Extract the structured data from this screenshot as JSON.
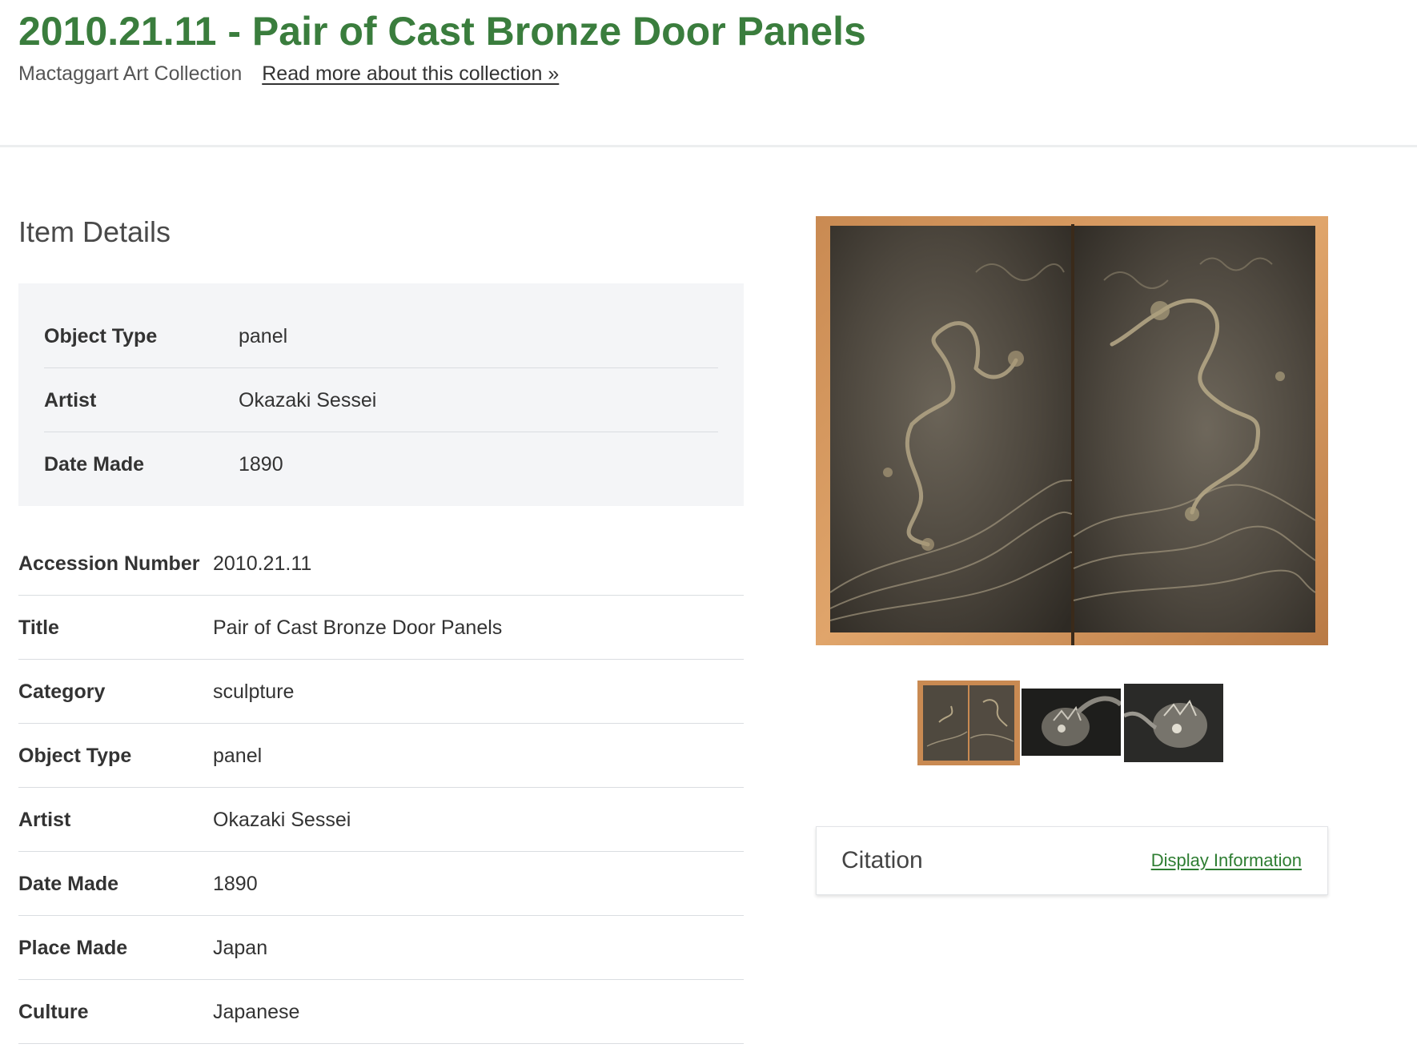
{
  "header": {
    "title": "2010.21.11 - Pair of Cast Bronze Door Panels",
    "collection_name": "Mactaggart Art Collection",
    "collection_link": "Read more about this collection »"
  },
  "item_details": {
    "heading": "Item Details",
    "summary": [
      {
        "label": "Object Type",
        "value": "panel"
      },
      {
        "label": "Artist",
        "value": "Okazaki Sessei"
      },
      {
        "label": "Date Made",
        "value": "1890"
      }
    ],
    "fields": [
      {
        "label": "Accession Number",
        "value": "2010.21.11"
      },
      {
        "label": "Title",
        "value": "Pair of Cast Bronze Door Panels"
      },
      {
        "label": "Category",
        "value": "sculpture"
      },
      {
        "label": "Object Type",
        "value": "panel"
      },
      {
        "label": "Artist",
        "value": "Okazaki Sessei"
      },
      {
        "label": "Date Made",
        "value": "1890"
      },
      {
        "label": "Place Made",
        "value": "Japan"
      },
      {
        "label": "Culture",
        "value": "Japanese"
      }
    ]
  },
  "gallery": {
    "main_image": "bronze-door-panels-dragons",
    "thumbnails": [
      "door-panels-full",
      "dragon-head-detail-1",
      "dragon-head-detail-2"
    ],
    "selected_thumbnail": 0
  },
  "citation": {
    "title": "Citation",
    "link": "Display Information"
  },
  "colors": {
    "title_green": "#3a7d3d",
    "link_green": "#2e7d32",
    "summary_bg": "#f4f5f7"
  }
}
